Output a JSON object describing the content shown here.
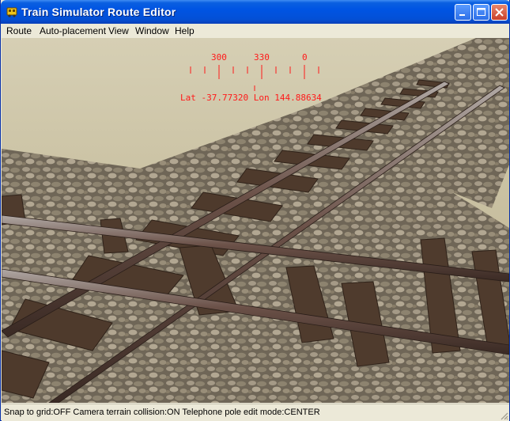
{
  "window": {
    "title": "Train Simulator Route Editor",
    "controls": [
      "minimize",
      "maximize",
      "close"
    ]
  },
  "menu": {
    "items": [
      "Route",
      "Auto-placement",
      "View",
      "Window",
      "Help"
    ]
  },
  "hud": {
    "compass_labels": [
      "300",
      "330",
      "0"
    ],
    "position": "Lat -37.77320 Lon 144.88634",
    "color": "#ff1a1a"
  },
  "status": {
    "text": "Snap to grid:OFF Camera terrain collision:ON Telephone pole edit mode:CENTER"
  },
  "colors": {
    "titlebar": "#0054e3",
    "menubar": "#ece9d8",
    "terrain": "#c8c09a",
    "ballast": "#7d7263",
    "sleepers": "#4a3628",
    "rails": "#5a4a42"
  }
}
